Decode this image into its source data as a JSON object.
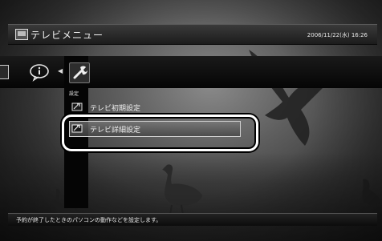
{
  "window": {
    "title": "テレビメニュー",
    "datetime": "2006/11/22(水) 16:26"
  },
  "iconbar": {
    "selected_label": "設定",
    "icons": [
      "tv-screen-icon",
      "info-icon",
      "wrench-icon"
    ]
  },
  "menu": {
    "items": [
      {
        "label": "テレビ初期設定",
        "icon": "settings-screen-icon",
        "selected": false
      },
      {
        "label": "テレビ詳細設定",
        "icon": "settings-screen-icon",
        "selected": true
      }
    ]
  },
  "status": {
    "text": "予約が終了したときのパソコンの動作などを設定します。"
  }
}
